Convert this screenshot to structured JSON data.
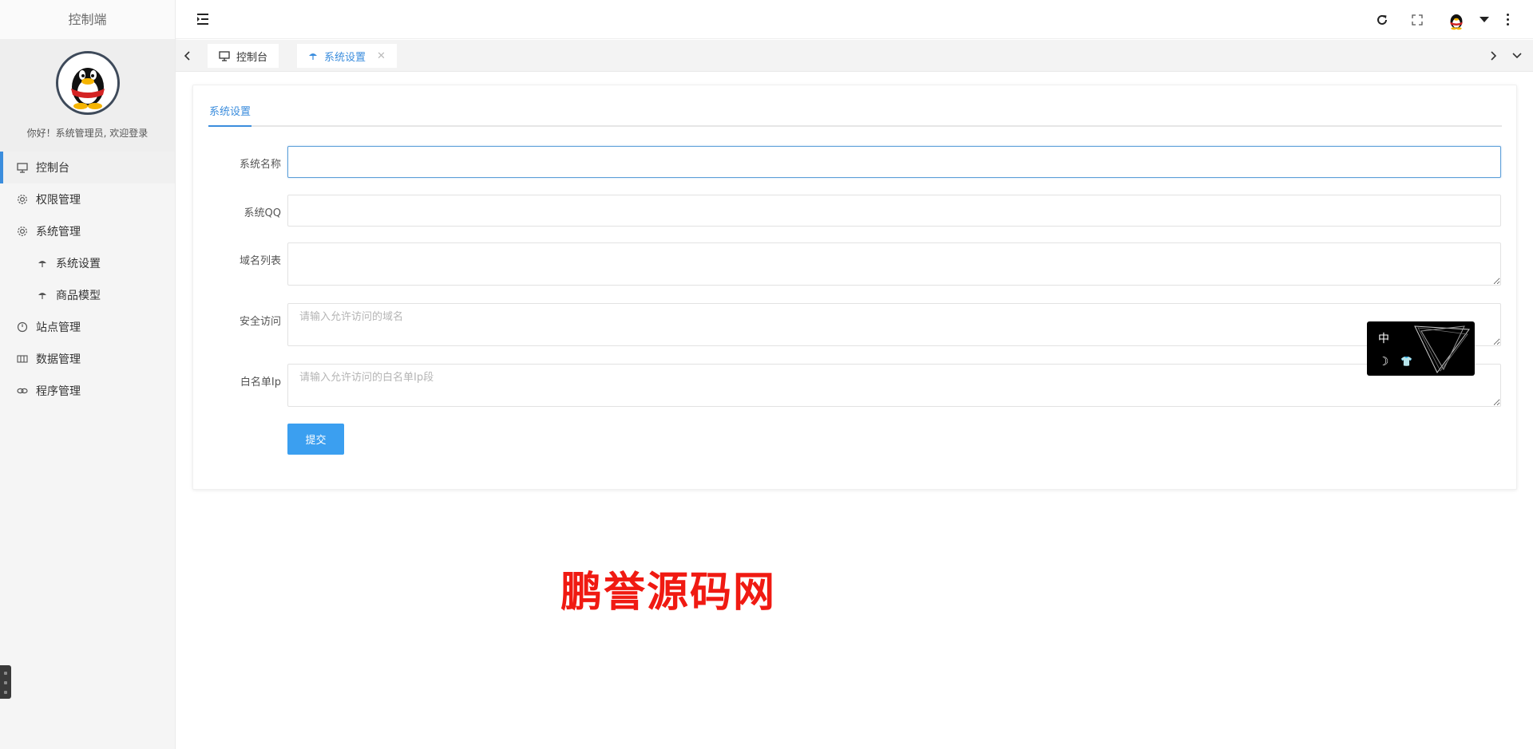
{
  "sidebar": {
    "title": "控制端",
    "welcome": "你好！系统管理员, 欢迎登录",
    "menu": [
      {
        "label": "控制台",
        "icon": "monitor-icon",
        "active": true
      },
      {
        "label": "权限管理",
        "icon": "gear-icon"
      },
      {
        "label": "系统管理",
        "icon": "gear-icon"
      },
      {
        "label": "系统设置",
        "icon": "umbrella-icon",
        "sub": true
      },
      {
        "label": "商品模型",
        "icon": "umbrella-icon",
        "sub": true
      },
      {
        "label": "站点管理",
        "icon": "clock-icon"
      },
      {
        "label": "数据管理",
        "icon": "table-icon"
      },
      {
        "label": "程序管理",
        "icon": "link-icon"
      }
    ]
  },
  "header": {
    "icons": [
      "menu-fold-icon",
      "refresh-icon",
      "fullscreen-icon",
      "user-avatar",
      "caret-down-icon",
      "more-vertical-icon"
    ]
  },
  "tabs": [
    {
      "label": "控制台",
      "icon": "monitor-icon",
      "active": false
    },
    {
      "label": "系统设置",
      "icon": "umbrella-icon",
      "active": true,
      "closable": true
    }
  ],
  "form": {
    "tab_label": "系统设置",
    "fields": [
      {
        "label": "系统名称",
        "value": "",
        "placeholder": ""
      },
      {
        "label": "系统QQ",
        "value": "",
        "placeholder": ""
      },
      {
        "label": "域名列表",
        "value": "",
        "placeholder": ""
      },
      {
        "label": "安全访问",
        "value": "",
        "placeholder": "请输入允许访问的域名"
      },
      {
        "label": "白名单Ip",
        "value": "",
        "placeholder": "请输入允许访问的白名单Ip段"
      }
    ],
    "submit_label": "提交"
  },
  "widget": {
    "lang": "中",
    "icons": [
      "moon-icon",
      "shirt-icon",
      "triangle-logo-icon"
    ]
  },
  "watermark": "鹏誉源码网",
  "colors": {
    "accent": "#3b8ddd",
    "button": "#3b9ff0",
    "watermark": "#f01a12",
    "sidebar_bg": "#f5f5f5"
  }
}
